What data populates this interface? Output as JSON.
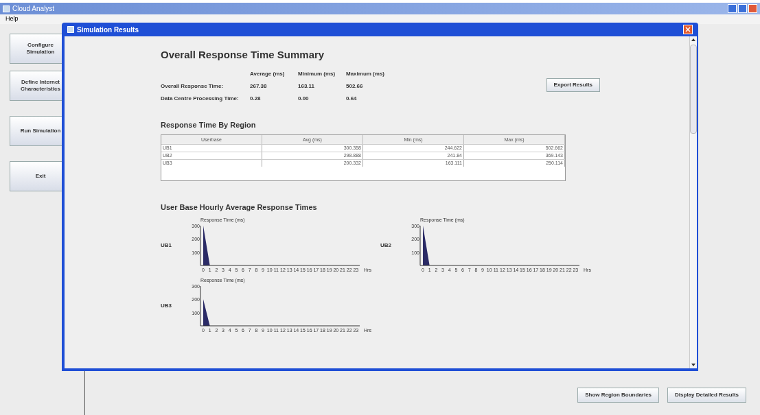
{
  "main_window": {
    "title": "Cloud Analyst",
    "menu": [
      "Help"
    ],
    "side_buttons": [
      "Configure Simulation",
      "Define Internet Characteristics",
      "Run Simulation",
      "Exit"
    ],
    "bottom_buttons": [
      "Show Region Boundaries",
      "Display Detailed Results"
    ]
  },
  "dialog": {
    "title": "Simulation Results",
    "summary": {
      "title": "Overall Response Time Summary",
      "columns": [
        "Average (ms)",
        "Minimum (ms)",
        "Maximum (ms)"
      ],
      "rows": [
        {
          "label": "Overall Response Time:",
          "values": [
            "267.38",
            "163.11",
            "502.66"
          ]
        },
        {
          "label": "Data Centre Processing Time:",
          "values": [
            "0.28",
            "0.00",
            "0.64"
          ]
        }
      ],
      "export_button": "Export Results"
    },
    "region_table": {
      "title": "Response Time By Region",
      "columns": [
        "Userbase",
        "Avg (ms)",
        "Min (ms)",
        "Max (ms)"
      ],
      "rows": [
        [
          "UB1",
          "300.358",
          "244.622",
          "502.662"
        ],
        [
          "UB2",
          "298.888",
          "241.84",
          "369.143"
        ],
        [
          "UB3",
          "200.332",
          "163.111",
          "250.114"
        ]
      ]
    },
    "hourly": {
      "title": "User Base Hourly Average Response Times",
      "charts": [
        {
          "label": "UB1",
          "chart_data": {
            "type": "area",
            "ylabel": "Response Time (ms)",
            "xlabel": "Hrs",
            "x": [
              0,
              1,
              2,
              3,
              4,
              5,
              6,
              7,
              8,
              9,
              10,
              11,
              12,
              13,
              14,
              15,
              16,
              17,
              18,
              19,
              20,
              21,
              22,
              23
            ],
            "series": [
              {
                "color": "#2b2b66",
                "values": [
                  300,
                  0,
                  0,
                  0,
                  0,
                  0,
                  0,
                  0,
                  0,
                  0,
                  0,
                  0,
                  0,
                  0,
                  0,
                  0,
                  0,
                  0,
                  0,
                  0,
                  0,
                  0,
                  0,
                  0
                ]
              }
            ],
            "ylim": [
              0,
              300
            ],
            "yticks": [
              100,
              200,
              300
            ]
          }
        },
        {
          "label": "UB2",
          "chart_data": {
            "type": "area",
            "ylabel": "Response Time (ms)",
            "xlabel": "Hrs",
            "x": [
              0,
              1,
              2,
              3,
              4,
              5,
              6,
              7,
              8,
              9,
              10,
              11,
              12,
              13,
              14,
              15,
              16,
              17,
              18,
              19,
              20,
              21,
              22,
              23
            ],
            "series": [
              {
                "color": "#2b2b66",
                "values": [
                  300,
                  0,
                  0,
                  0,
                  0,
                  0,
                  0,
                  0,
                  0,
                  0,
                  0,
                  0,
                  0,
                  0,
                  0,
                  0,
                  0,
                  0,
                  0,
                  0,
                  0,
                  0,
                  0,
                  0
                ]
              }
            ],
            "ylim": [
              0,
              300
            ],
            "yticks": [
              100,
              200,
              300
            ]
          }
        },
        {
          "label": "UB3",
          "chart_data": {
            "type": "area",
            "ylabel": "Response Time (ms)",
            "xlabel": "Hrs",
            "x": [
              0,
              1,
              2,
              3,
              4,
              5,
              6,
              7,
              8,
              9,
              10,
              11,
              12,
              13,
              14,
              15,
              16,
              17,
              18,
              19,
              20,
              21,
              22,
              23
            ],
            "series": [
              {
                "color": "#2b2b66",
                "values": [
                  200,
                  0,
                  0,
                  0,
                  0,
                  0,
                  0,
                  0,
                  0,
                  0,
                  0,
                  0,
                  0,
                  0,
                  0,
                  0,
                  0,
                  0,
                  0,
                  0,
                  0,
                  0,
                  0,
                  0
                ]
              }
            ],
            "ylim": [
              0,
              300
            ],
            "yticks": [
              100,
              200,
              300
            ]
          }
        }
      ]
    }
  }
}
